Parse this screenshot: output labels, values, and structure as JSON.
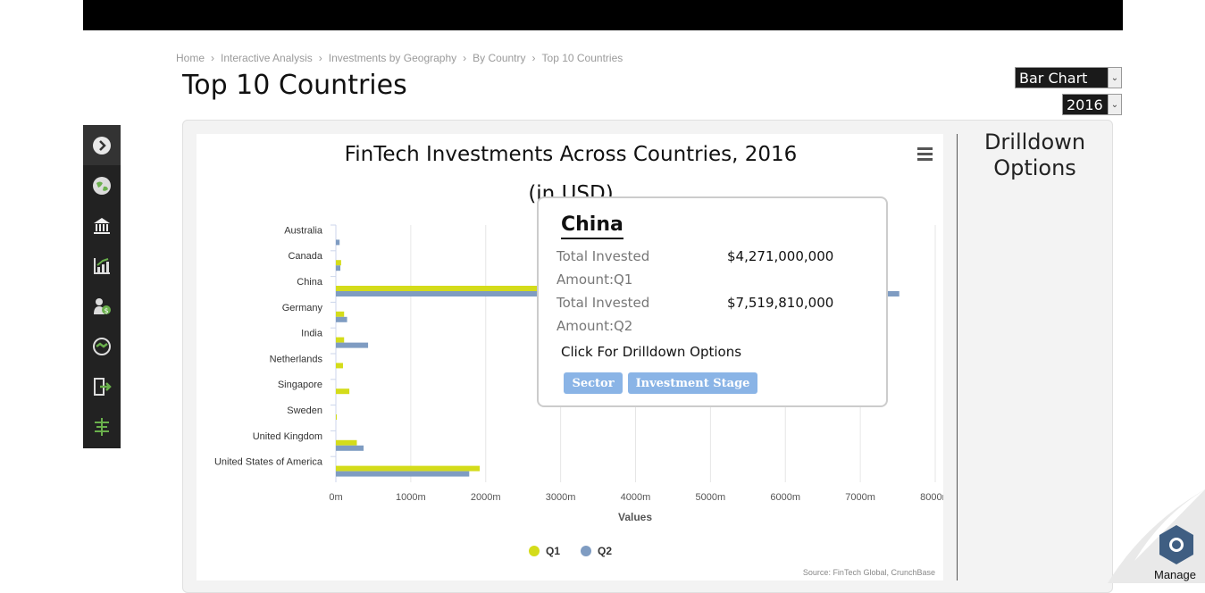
{
  "breadcrumb": [
    "Home",
    "Interactive Analysis",
    "Investments by Geography",
    "By Country",
    "Top 10 Countries"
  ],
  "breadcrumb_sep": "›",
  "page_title": "Top 10 Countries",
  "controls": {
    "chart_type": "Bar Chart",
    "year": "2016"
  },
  "drilldown_title": "Drilldown Options",
  "colors": {
    "q1": "#d4dc1a",
    "q2": "#7f9cc2",
    "grid": "#e6e6e6"
  },
  "chart_data": {
    "type": "bar",
    "orientation": "horizontal",
    "title": "FinTech Investments Across Countries, 2016",
    "subtitle": "(in USD)",
    "categories": [
      "Australia",
      "Canada",
      "China",
      "Germany",
      "India",
      "Netherlands",
      "Singapore",
      "Sweden",
      "United Kingdom",
      "United States of America"
    ],
    "series": [
      {
        "name": "Q1",
        "values": [
          0,
          70,
          4271,
          110,
          110,
          95,
          180,
          5,
          280,
          1920
        ]
      },
      {
        "name": "Q2",
        "values": [
          50,
          60,
          7520,
          150,
          430,
          0,
          0,
          0,
          370,
          1780
        ]
      }
    ],
    "xticks": [
      "0m",
      "1000m",
      "2000m",
      "3000m",
      "4000m",
      "5000m",
      "6000m",
      "7000m",
      "8000m"
    ],
    "xlim": [
      0,
      8000
    ],
    "xlabel": "Values",
    "ylabel": "",
    "legend_position": "bottom",
    "grid": true,
    "credits": "Source: FinTech Global, CrunchBase"
  },
  "tooltip": {
    "country": "China",
    "q1_label": "Total Invested Amount:Q1",
    "q1_value": "$4,271,000,000",
    "q2_label": "Total Invested Amount:Q2",
    "q2_value": "$7,519,810,000",
    "hint": "Click For Drilldown Options",
    "btn_sector": "Sector",
    "btn_stage": "Investment Stage"
  },
  "manage_label": "Manage"
}
